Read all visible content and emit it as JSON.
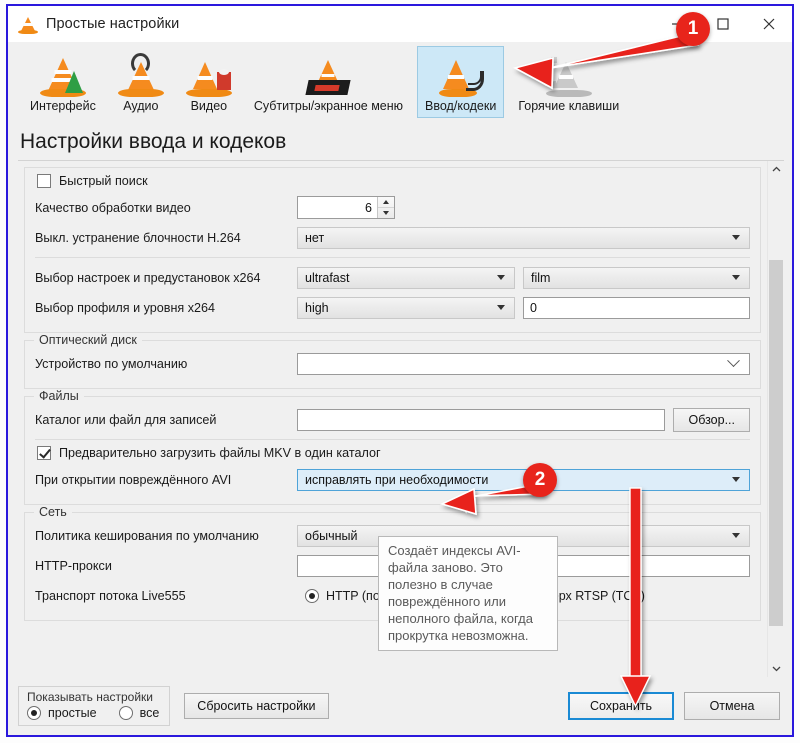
{
  "window": {
    "title": "Простые настройки",
    "icon": "vlc-cone-icon",
    "border_color": "#2a18dd",
    "buttons": {
      "minimize": "—",
      "maximize": "□",
      "close": "✕"
    }
  },
  "toolbar": {
    "tabs": [
      {
        "label": "Интерфейс",
        "icon": "vlc-cone-interface-icon",
        "selected": false
      },
      {
        "label": "Аудио",
        "icon": "vlc-cone-headphones-icon",
        "selected": false
      },
      {
        "label": "Видео",
        "icon": "vlc-cone-popcorn-icon",
        "selected": false
      },
      {
        "label": "Субтитры/экранное меню",
        "icon": "vlc-cone-subtitles-icon",
        "selected": false
      },
      {
        "label": "Ввод/кодеки",
        "icon": "vlc-cone-input-codecs-icon",
        "selected": true
      },
      {
        "label": "Горячие клавиши",
        "icon": "vlc-cone-hotkeys-icon",
        "selected": false
      }
    ]
  },
  "page": {
    "heading": "Настройки ввода и кодеков"
  },
  "settings": {
    "fast_seek": {
      "label": "Быстрый поиск",
      "checked": false
    },
    "video_quality": {
      "label": "Качество обработки видео",
      "value": "6"
    },
    "h264_deblocking": {
      "label": "Выкл. устранение блочности H.264",
      "value": "нет"
    },
    "x264_preset": {
      "label": "Выбор настроек и предустановок x264",
      "value": "ultrafast",
      "value2": "film"
    },
    "x264_profile": {
      "label": "Выбор профиля и уровня x264",
      "value": "high",
      "value2": "0"
    },
    "optical_disc": {
      "title": "Оптический диск",
      "default_device": {
        "label": "Устройство по умолчанию",
        "value": ""
      }
    },
    "files": {
      "title": "Файлы",
      "record_dir": {
        "label": "Каталог или файл для записей",
        "value": "",
        "browse_button": "Обзор..."
      },
      "preload_mkv": {
        "label": "Предварительно загрузить файлы MKV в один каталог",
        "checked": true
      },
      "damaged_avi": {
        "label": "При открытии повреждённого AVI",
        "value": "исправлять при необходимости"
      }
    },
    "network": {
      "title": "Сеть",
      "cache_policy": {
        "label": "Политика кеширования по умолчанию",
        "value": "обычный"
      },
      "http_proxy": {
        "label": "HTTP-прокси",
        "value": ""
      },
      "live555_transport": {
        "label": "Транспорт потока Live555",
        "options": [
          {
            "label": "HTTP (по умолчанию)",
            "selected": true
          },
          {
            "label": "RTP поверх RTSP (TCP)",
            "selected": false
          }
        ]
      }
    }
  },
  "tooltip": {
    "text": "Создаёт индексы AVI-файла заново. Это полезно в случае повреждённого или неполного файла, когда прокрутка невозможна."
  },
  "footer": {
    "show_settings": {
      "title": "Показывать настройки",
      "options": [
        {
          "label": "простые",
          "selected": true
        },
        {
          "label": "все",
          "selected": false
        }
      ]
    },
    "reset_button": "Сбросить настройки",
    "save_button": "Сохранить",
    "cancel_button": "Отмена"
  },
  "callouts": {
    "accent_color": "#e8241b",
    "items": [
      {
        "number": "1",
        "points_to": "tab-input-codecs"
      },
      {
        "number": "2",
        "points_to": "damaged-avi-combo-and-save-button"
      }
    ]
  }
}
